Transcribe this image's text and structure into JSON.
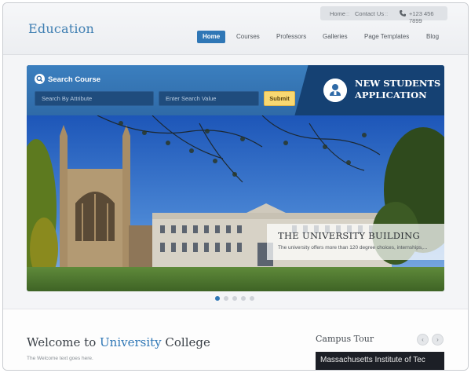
{
  "header": {
    "logo": "Education",
    "topbar": {
      "home": "Home",
      "separator": "::",
      "contact": "Contact Us",
      "phone": "+123 456 7899",
      "phone_icon": "phone-icon"
    },
    "nav": [
      {
        "label": "Home",
        "active": true
      },
      {
        "label": "Courses"
      },
      {
        "label": "Professors"
      },
      {
        "label": "Galleries"
      },
      {
        "label": "Page Templates"
      },
      {
        "label": "Blog"
      }
    ]
  },
  "search": {
    "title": "Search Course",
    "icon": "search-icon",
    "attribute_placeholder": "Search By Attribute",
    "value_placeholder": "Enter Search Value",
    "submit": "Submit"
  },
  "apply": {
    "line1": "NEW STUDENTS",
    "line2": "APPLICATION",
    "icon": "student-icon"
  },
  "slide": {
    "title": "THE UNIVERSITY BUILDING",
    "text": "The university offers more than 120 degree choices, internships,..."
  },
  "slider_dots": {
    "count": 5,
    "active_index": 0
  },
  "welcome": {
    "pre": "Welcome to",
    "highlight": "University",
    "post": "College",
    "sub": "The Welcome text goes here."
  },
  "tour": {
    "title": "Campus Tour",
    "prev": "‹",
    "next": "›",
    "image_text": "Massachusetts Institute of Tec"
  },
  "colors": {
    "accent": "#2f77b6",
    "dark_blue": "#154173",
    "submit": "#f8d872"
  }
}
